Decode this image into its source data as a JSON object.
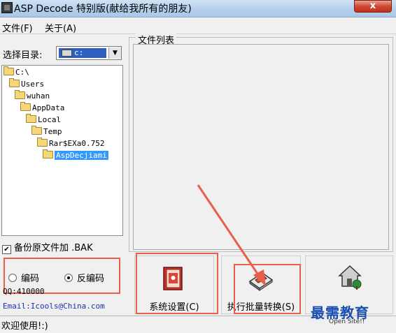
{
  "window": {
    "title": "ASP Decode 特别版(献给我所有的朋友)",
    "close_label": "x"
  },
  "menu": [
    {
      "label": "文件(F)"
    },
    {
      "label": "关于(A)"
    }
  ],
  "left": {
    "dir_label": "选择目录:",
    "drive": {
      "value": "c:",
      "icon": "drive-icon"
    },
    "tree": [
      {
        "label": "C:\\"
      },
      {
        "label": "Users"
      },
      {
        "label": "wuhan"
      },
      {
        "label": "AppData"
      },
      {
        "label": "Local"
      },
      {
        "label": "Temp"
      },
      {
        "label": "Rar$EXa0.752"
      },
      {
        "label": "AspDecjiami",
        "selected": true
      }
    ],
    "backup": {
      "label": "备份原文件加 .BAK",
      "checked": true
    },
    "encode_label": "编码",
    "decode_label": "反编码",
    "qq": "QQ:410000",
    "email": "Email:Icools@China.com"
  },
  "right": {
    "group_label": "文件列表",
    "buttons": [
      {
        "label": "系统设置(C)",
        "icon": "settings-book-icon"
      },
      {
        "label": "执行批量转换(S)",
        "icon": "convert-icon"
      },
      {
        "label": "",
        "icon": "home-icon"
      }
    ]
  },
  "status": {
    "text": "欢迎使用!:)"
  },
  "overlay": {
    "watermark": "最需教育",
    "open_site": "Open Site!!"
  },
  "colors": {
    "highlight": "#e8604a",
    "selection": "#3399ff"
  }
}
